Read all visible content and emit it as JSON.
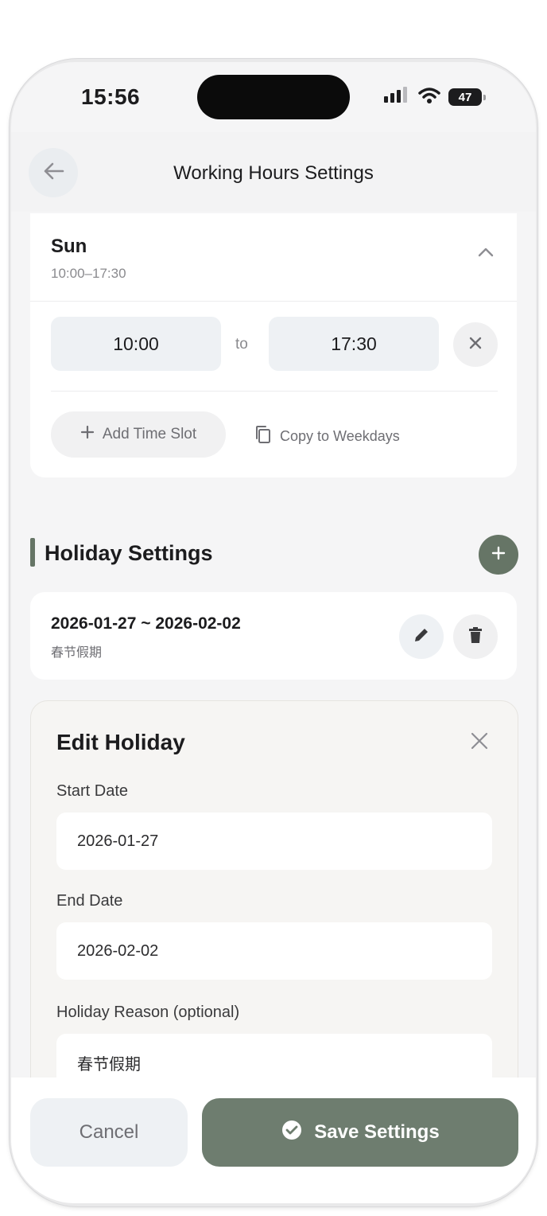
{
  "status_bar": {
    "time": "15:56",
    "battery": "47"
  },
  "header": {
    "title": "Working Hours Settings"
  },
  "day": {
    "name": "Sun",
    "summary": "10:00–17:30",
    "start_time": "10:00",
    "to_label": "to",
    "end_time": "17:30",
    "add_slot_label": "Add Time Slot",
    "copy_label": "Copy to Weekdays"
  },
  "holidays": {
    "section_title": "Holiday Settings",
    "items": [
      {
        "range": "2026-01-27 ~ 2026-02-02",
        "reason": "春节假期"
      }
    ]
  },
  "edit_holiday": {
    "title": "Edit Holiday",
    "start_label": "Start Date",
    "start_value": "2026-01-27",
    "end_label": "End Date",
    "end_value": "2026-02-02",
    "reason_label": "Holiday Reason (optional)",
    "reason_value": "春节假期"
  },
  "footer": {
    "cancel_label": "Cancel",
    "save_label": "Save Settings"
  },
  "colors": {
    "accent": "#667566",
    "save_button": "#6e7d6f",
    "input_bg": "#eef1f4"
  },
  "icons": [
    "back-arrow-icon",
    "chevron-up-icon",
    "close-icon",
    "plus-icon",
    "copy-icon",
    "pencil-icon",
    "trash-icon",
    "check-circle-icon",
    "signal-icon",
    "wifi-icon",
    "battery-icon"
  ]
}
